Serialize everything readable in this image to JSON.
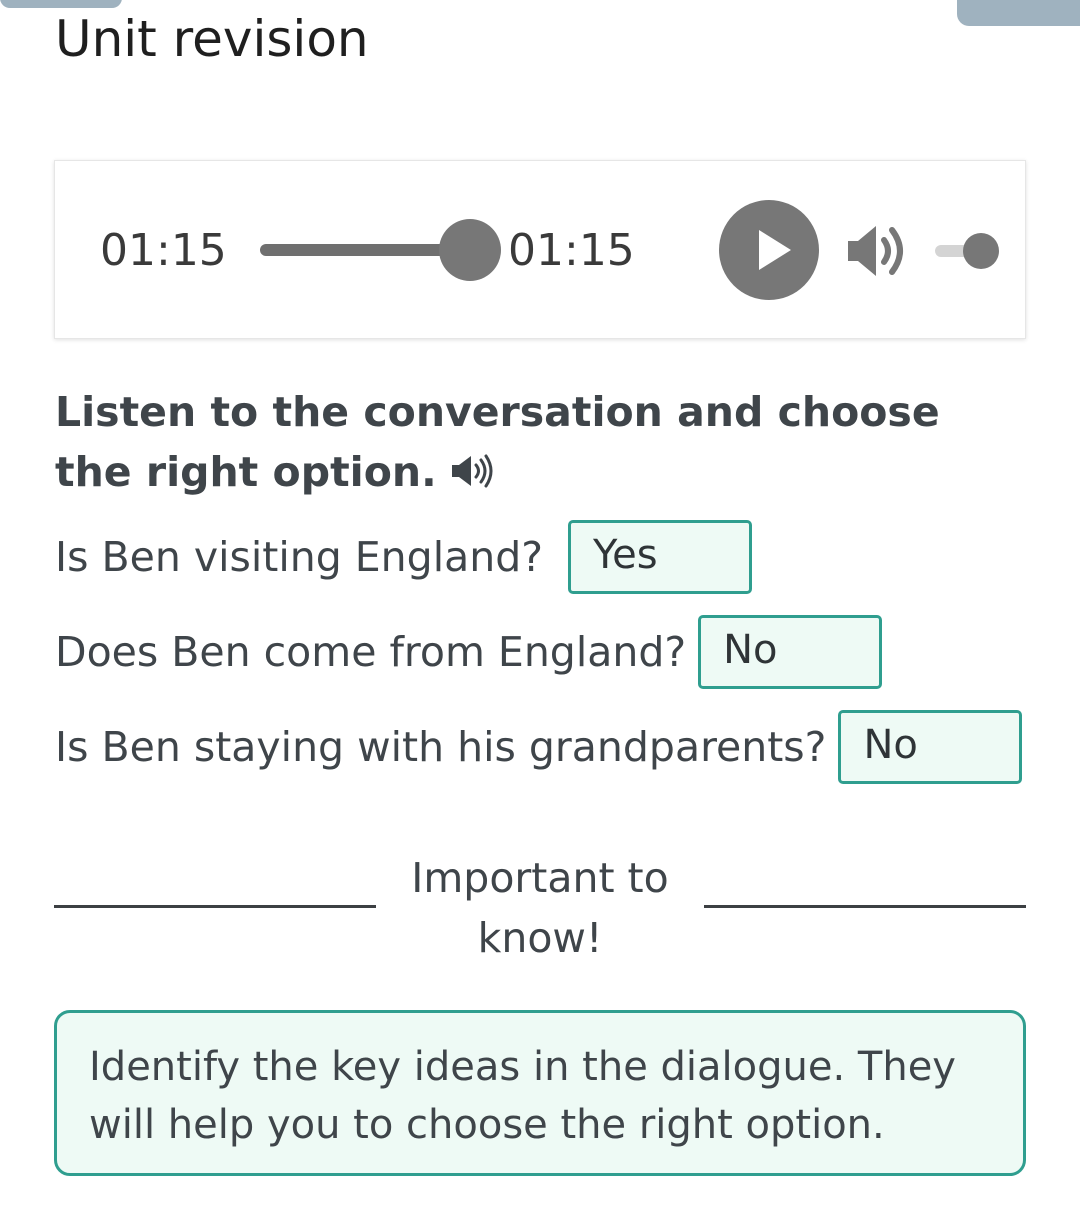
{
  "page": {
    "title": "Unit revision"
  },
  "player": {
    "current_time": "01:15",
    "total_time": "01:15",
    "progress": 1.0,
    "volume": 1.0,
    "play_icon": "play-icon",
    "volume_icon": "volume-icon"
  },
  "exercise": {
    "instruction": "Listen to the conversation and choose the right option.",
    "instruction_icon": "speaker-icon",
    "questions": [
      {
        "text": "Is Ben visiting England?",
        "answer": "Yes"
      },
      {
        "text": "Does Ben come from England?",
        "answer": "No"
      },
      {
        "text": "Is Ben staying with his grandparents?",
        "answer": "No"
      }
    ]
  },
  "tip": {
    "heading": "Important to know!",
    "text": "Identify the key ideas in the dialogue. They will help you to choose the right option."
  },
  "colors": {
    "accent": "#2f9e8f",
    "answer_bg": "#eefaf5",
    "player_grey": "#777777",
    "tab_grey": "#9fb2bf"
  }
}
